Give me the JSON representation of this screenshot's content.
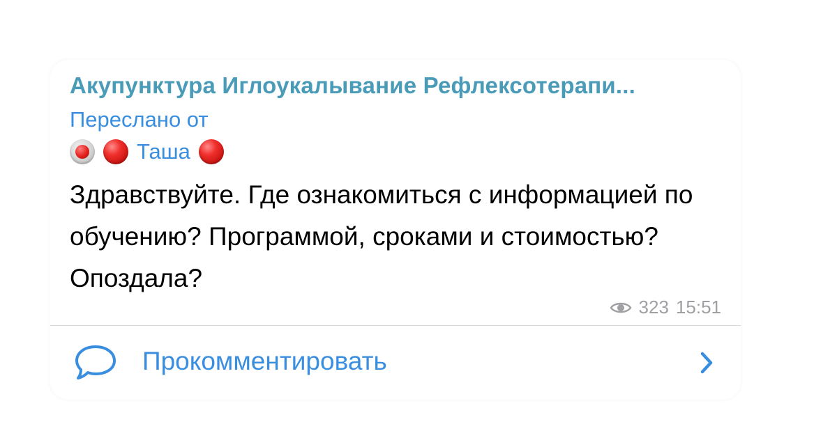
{
  "theme": {
    "accent": "#3a8ee0",
    "channel_color": "#4a9bb8"
  },
  "post": {
    "channel_name": "Акупунктура Иглоукалывание Рефлексотерапи...",
    "forwarded_label": "Переслано от",
    "author_name": "Таша",
    "message": "Здравствуйте. Где ознакомиться с информацией по обучению? Программой, сроками и стоимостью? Опоздала?",
    "views": "323",
    "time": "15:51",
    "icons": {
      "views": "eye-icon",
      "comment": "speech-bubble-icon",
      "chevron": "chevron-right-icon",
      "emoji_button": "radio-button-emoji",
      "emoji_circle": "red-circle-emoji"
    }
  },
  "comments": {
    "label": "Прокомментировать"
  }
}
